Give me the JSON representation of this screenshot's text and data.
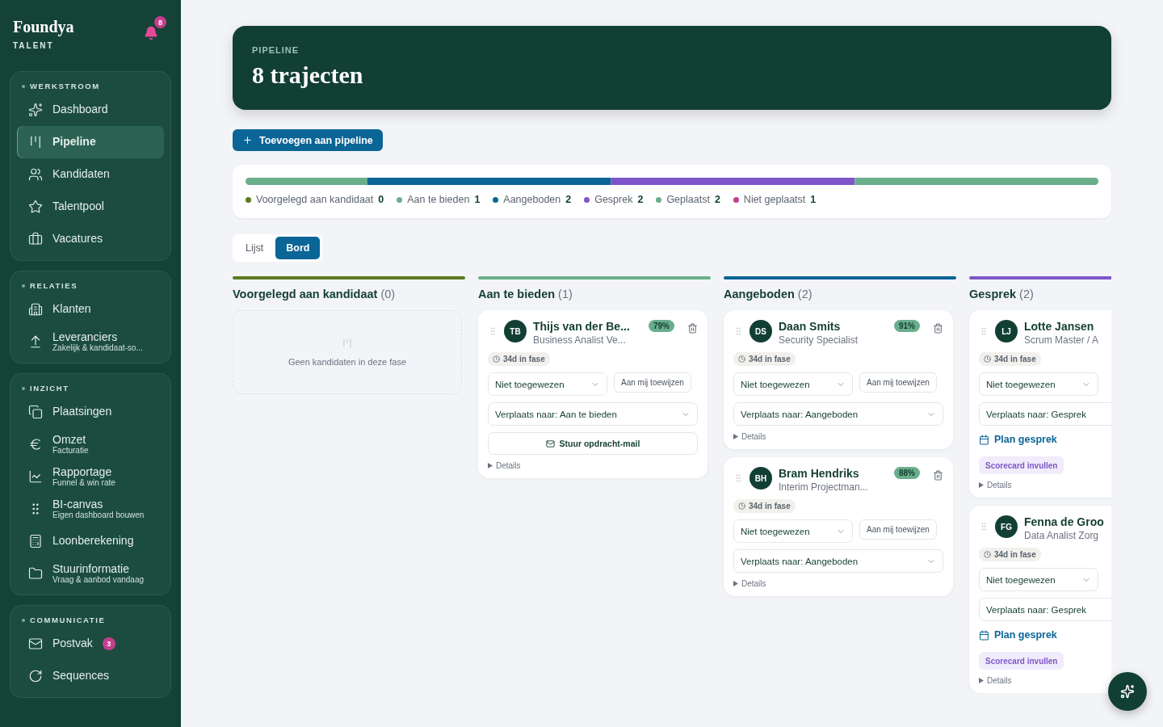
{
  "brand": {
    "name": "Foundya",
    "subtitle": "TALENT",
    "notifications": "8"
  },
  "sidebar": {
    "sections": [
      {
        "title": "WERKSTROOM",
        "items": [
          {
            "label": "Dashboard",
            "selected": false
          },
          {
            "label": "Pipeline",
            "selected": true
          },
          {
            "label": "Kandidaten",
            "selected": false
          },
          {
            "label": "Talentpool",
            "selected": false
          },
          {
            "label": "Vacatures",
            "selected": false
          }
        ]
      },
      {
        "title": "RELATIES",
        "items": [
          {
            "label": "Klanten",
            "selected": false
          },
          {
            "label": "Leveranciers",
            "sublabel": "Zakelijk & kandidaat-so...",
            "selected": false
          }
        ]
      },
      {
        "title": "INZICHT",
        "items": [
          {
            "label": "Plaatsingen",
            "selected": false
          },
          {
            "label": "Omzet",
            "sublabel": "Facturatie",
            "selected": false
          },
          {
            "label": "Rapportage",
            "sublabel": "Funnel & win rate",
            "selected": false
          },
          {
            "label": "BI-canvas",
            "sublabel": "Eigen dashboard bouwen",
            "selected": false
          },
          {
            "label": "Loonberekening",
            "selected": false
          },
          {
            "label": "Stuurinformatie",
            "sublabel": "Vraag & aanbod vandaag",
            "selected": false
          }
        ]
      },
      {
        "title": "COMMUNICATIE",
        "items": [
          {
            "label": "Postvak",
            "badge": "3",
            "selected": false
          },
          {
            "label": "Sequences",
            "selected": false
          }
        ]
      }
    ]
  },
  "header": {
    "eyebrow": "PIPELINE",
    "title": "8 trajecten"
  },
  "add_button": "Toevoegen aan pipeline",
  "stages": [
    {
      "kind": "active",
      "label": "Voorgelegd aan kandidaat",
      "count": "0",
      "color": "#5b7a1f"
    },
    {
      "kind": "active",
      "label": "Aan te bieden",
      "count": "1",
      "color": "#6aae8c"
    },
    {
      "kind": "active",
      "label": "Aangeboden",
      "count": "2",
      "color": "#0b6597"
    },
    {
      "kind": "active",
      "label": "Gesprek",
      "count": "2",
      "color": "#7f56c9"
    },
    {
      "kind": "active",
      "label": "Geplaatst",
      "count": "2",
      "color": "#6aae8c"
    },
    {
      "kind": "lost",
      "label": "Niet geplaatst",
      "count": "1",
      "color": "#c43e8e"
    }
  ],
  "view_toggle": [
    {
      "label": "Lijst",
      "selected": false
    },
    {
      "label": "Bord",
      "selected": true
    }
  ],
  "columns": [
    {
      "title": "Voorgelegd aan kandidaat",
      "count": "(0)",
      "color": "#5b7a1f",
      "empty_text": "Geen kandidaten in deze fase"
    },
    {
      "title": "Aan te bieden",
      "count": "(1)",
      "color": "#6aae8c",
      "cards": [
        {
          "initials": "TB",
          "name": "Thijs van der Be...",
          "role": "Business Analist Ve...",
          "match": "79%",
          "age": "34d in fase",
          "assignee": "Niet toegewezen",
          "assign_button": "Aan mij toewijzen",
          "move": "Verplaats naar: Aan te bieden",
          "mail_button": "Stuur opdracht-mail",
          "details": "Details"
        }
      ]
    },
    {
      "title": "Aangeboden",
      "count": "(2)",
      "color": "#0b6597",
      "cards": [
        {
          "initials": "DS",
          "name": "Daan Smits",
          "role": "Security Specialist",
          "match": "91%",
          "age": "34d in fase",
          "assignee": "Niet toegewezen",
          "assign_button": "Aan mij toewijzen",
          "move": "Verplaats naar: Aangeboden",
          "details": "Details"
        },
        {
          "initials": "BH",
          "name": "Bram Hendriks",
          "role": "Interim Projectman...",
          "match": "88%",
          "age": "34d in fase",
          "assignee": "Niet toegewezen",
          "assign_button": "Aan mij toewijzen",
          "move": "Verplaats naar: Aangeboden",
          "details": "Details"
        }
      ]
    },
    {
      "title": "Gesprek",
      "count": "(2)",
      "color": "#7f56c9",
      "cards": [
        {
          "initials": "LJ",
          "name": "Lotte Jansen",
          "role": "Scrum Master / A",
          "age": "34d in fase",
          "assignee": "Niet toegewezen",
          "move": "Verplaats naar: Gesprek",
          "plan_link": "Plan gesprek",
          "scorecard": "Scorecard invullen",
          "details": "Details"
        },
        {
          "initials": "FG",
          "name": "Fenna de Groo",
          "role": "Data Analist Zorg",
          "age": "34d in fase",
          "assignee": "Niet toegewezen",
          "move": "Verplaats naar: Gesprek",
          "plan_link": "Plan gesprek",
          "scorecard": "Scorecard invullen",
          "details": "Details"
        }
      ]
    }
  ]
}
